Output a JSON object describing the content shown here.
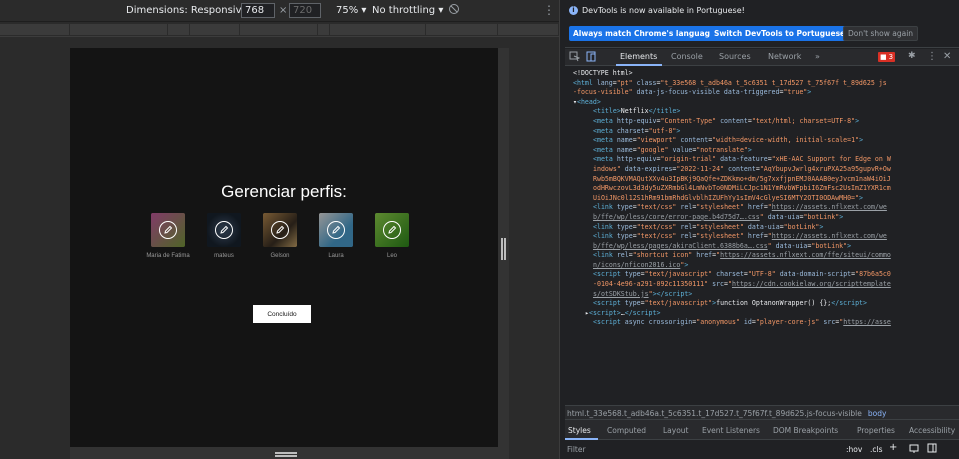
{
  "toolbar": {
    "dimensions_label": "Dimensions: Responsive",
    "width": "768",
    "height_placeholder": "720",
    "times": "×",
    "zoom": "75%",
    "throttling": "No throttling"
  },
  "page": {
    "title": "Gerenciar perfis:",
    "profiles": [
      {
        "name": "Maria de Fatima",
        "color": "#b9478a"
      },
      {
        "name": "mateus",
        "color": "#1f2b38"
      },
      {
        "name": "Gelson",
        "color": "#8a6a3c"
      },
      {
        "name": "Laura",
        "color": "#3a7fa8"
      },
      {
        "name": "Leo",
        "color": "#5ab52a"
      }
    ],
    "done_label": "Concluído"
  },
  "devtools": {
    "info_text": "DevTools is now available in Portuguese!",
    "btn_match": "Always match Chrome's language",
    "btn_switch": "Switch DevTools to Portuguese",
    "btn_dont_show": "Don't show again",
    "tabs": [
      "Elements",
      "Console",
      "Sources",
      "Network"
    ],
    "more_tabs": "»",
    "error_count": "3",
    "breadcrumb_path": "html.t_33e568.t_adb46a.t_5c6351.t_17d527.t_75f67f.t_89d625.js-focus-visible",
    "breadcrumb_current": "body",
    "subtabs": [
      "Styles",
      "Computed",
      "Layout",
      "Event Listeners",
      "DOM Breakpoints",
      "Properties",
      "Accessibility"
    ],
    "filter_placeholder": "Filter",
    "hov": ":hov",
    "cls": ".cls",
    "plus": "+"
  },
  "colors": {
    "accent": "#8ab4f8",
    "primary_button": "#1a73e8",
    "error": "#d93025",
    "netflix_bg": "#141414"
  }
}
